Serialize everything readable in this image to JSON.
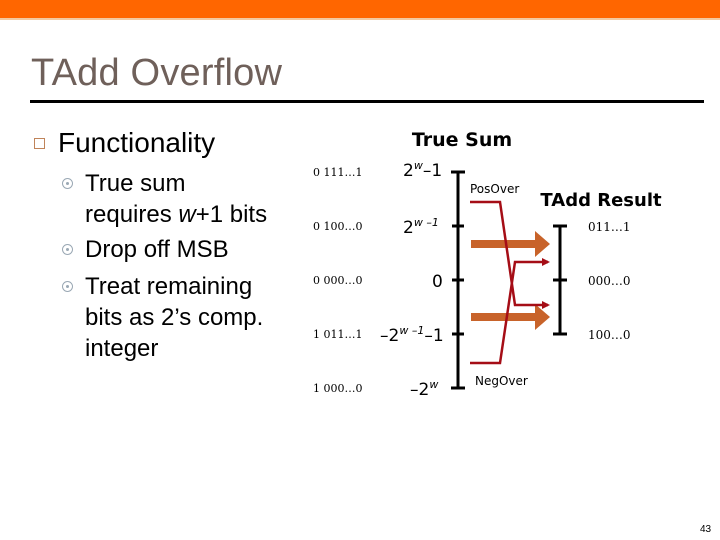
{
  "slide": {
    "title": "TAdd Overflow",
    "page_number": "43",
    "accent_color": "#ff6600"
  },
  "bullets": {
    "heading": "Functionality",
    "items": [
      {
        "lines": [
          "True sum",
          "requires w+1 bits"
        ],
        "italic_token": "w"
      },
      {
        "lines": [
          "Drop off MSB"
        ]
      },
      {
        "lines": [
          "Treat remaining",
          "bits as 2’s comp.",
          "integer"
        ]
      }
    ]
  },
  "diagram": {
    "true_sum_title": "True Sum",
    "tadd_result_title": "TAdd Result",
    "bit_patterns": [
      "0 111…1",
      "0 100…0",
      "0 000…0",
      "1 011…1",
      "1 000…0"
    ],
    "true_sum_labels": [
      {
        "base": "2",
        "sup": "w",
        "suffix": "–1"
      },
      {
        "base": "2",
        "sup": "w –1",
        "suffix": ""
      },
      {
        "base": "0",
        "sup": "",
        "suffix": ""
      },
      {
        "base": "–2",
        "sup": "w –1",
        "suffix": "–1"
      },
      {
        "base": "–2",
        "sup": "w",
        "suffix": ""
      }
    ],
    "result_labels": [
      "011…1",
      "000…0",
      "100…0"
    ],
    "pos_over_label": "PosOver",
    "neg_over_label": "NegOver",
    "colors": {
      "axis": "#000000",
      "overflow_line": "#a50d16",
      "mapping_arrow": "#c8632a"
    }
  }
}
